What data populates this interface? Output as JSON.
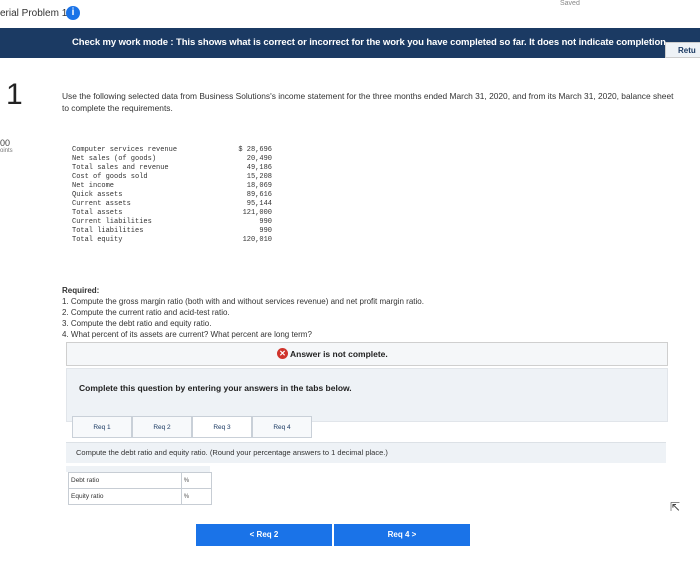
{
  "header": {
    "title": "erial Problem 13",
    "info_icon": "i",
    "saved": "Saved"
  },
  "mode_bar": {
    "text": "Check my work mode : This shows what is correct or incorrect for the work you have completed so far. It does not indicate completion."
  },
  "return_button": "Retu",
  "question": {
    "number": "1",
    "points_value": "00",
    "points_label": "oints",
    "prompt": "Use the following selected data from Business Solutions's income statement for the three months ended March 31, 2020, and from its March 31, 2020, balance sheet to complete the requirements."
  },
  "data_table": [
    {
      "label": "Computer services revenue",
      "value": "$ 28,696"
    },
    {
      "label": "Net sales (of goods)",
      "value": "20,490"
    },
    {
      "label": "Total sales and revenue",
      "value": "49,186"
    },
    {
      "label": "Cost of goods sold",
      "value": "15,208"
    },
    {
      "label": "Net income",
      "value": "18,069"
    },
    {
      "label": "Quick assets",
      "value": "89,616"
    },
    {
      "label": "Current assets",
      "value": "95,144"
    },
    {
      "label": "Total assets",
      "value": "121,000"
    },
    {
      "label": "Current liabilities",
      "value": "990"
    },
    {
      "label": "Total liabilities",
      "value": "990"
    },
    {
      "label": "Total equity",
      "value": "120,010"
    }
  ],
  "required": {
    "heading": "Required:",
    "items": [
      "1. Compute the gross margin ratio (both with and without services revenue) and net profit margin ratio.",
      "2. Compute the current ratio and acid-test ratio.",
      "3. Compute the debt ratio and equity ratio.",
      "4. What percent of its assets are current? What percent are long term?"
    ]
  },
  "answer_status": {
    "icon": "x-icon",
    "text": "Answer is not complete."
  },
  "instructions": "Complete this question by entering your answers in the tabs below.",
  "tabs": [
    "Req 1",
    "Req 2",
    "Req 3",
    "Req 4"
  ],
  "compute_text": "Compute the debt ratio and equity ratio. (Round your percentage answers to 1 decimal place.)",
  "answer_rows": [
    {
      "label": "Debt ratio",
      "unit": "%"
    },
    {
      "label": "Equity ratio",
      "unit": "%"
    }
  ],
  "nav": {
    "prev_label": "Req 2",
    "next_label": "Req 4"
  }
}
